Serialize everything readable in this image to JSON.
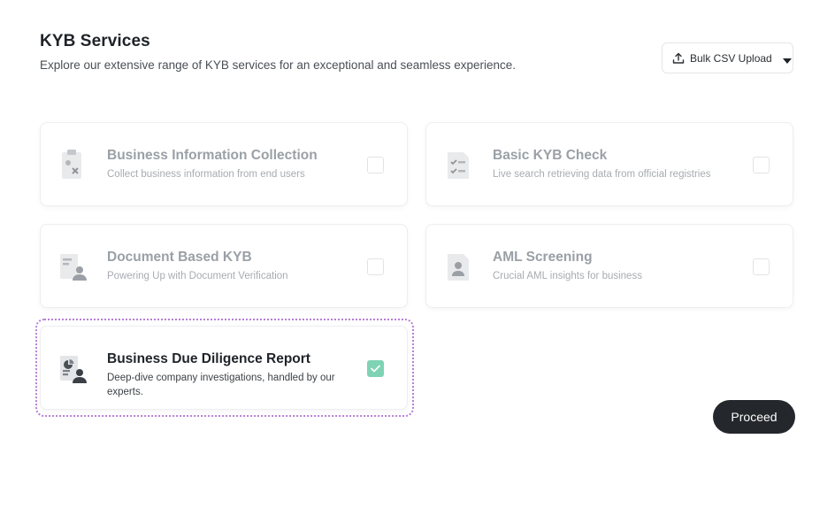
{
  "header": {
    "title": "KYB Services",
    "subtitle": "Explore our extensive range of KYB services for an exceptional and seamless experience."
  },
  "bulk_upload": {
    "label": "Bulk CSV Upload"
  },
  "services": [
    {
      "title": "Business Information Collection",
      "description": "Collect business information from end users",
      "checked": false
    },
    {
      "title": "Basic KYB Check",
      "description": "Live search retrieving data from official registries",
      "checked": false
    },
    {
      "title": "Document Based KYB",
      "description": "Powering Up with Document Verification",
      "checked": false
    },
    {
      "title": "AML Screening",
      "description": "Crucial AML insights for business",
      "checked": false
    },
    {
      "title": "Business Due Diligence Report",
      "description": "Deep-dive company investigations, handled by our experts.",
      "checked": true
    }
  ],
  "actions": {
    "proceed_label": "Proceed"
  },
  "colors": {
    "accent_check": "#7fd3b4",
    "selection_outline": "#b77fd6",
    "primary_button": "#24272b"
  }
}
